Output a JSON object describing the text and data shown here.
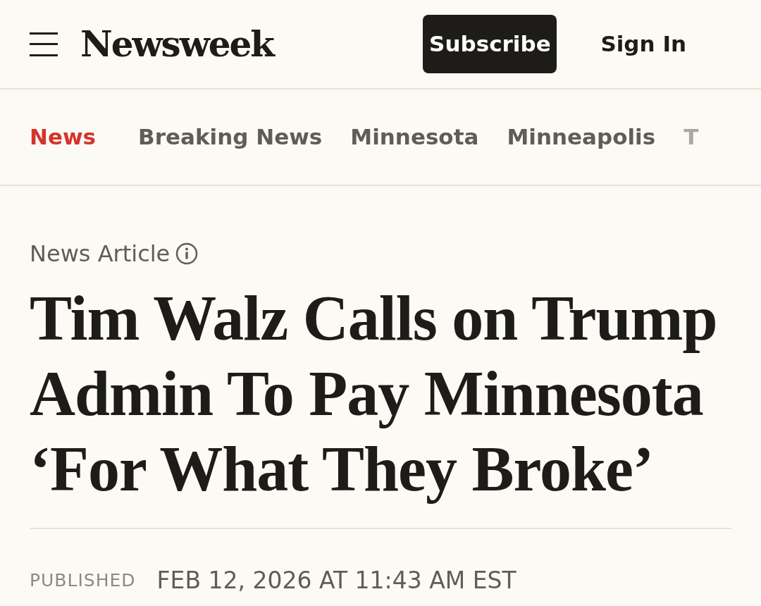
{
  "header": {
    "brand": "Newsweek",
    "subscribe": "Subscribe",
    "sign_in": "Sign In"
  },
  "nav": [
    {
      "label": "News",
      "selected": true
    },
    {
      "label": "Breaking News",
      "selected": false
    },
    {
      "label": "Minnesota",
      "selected": false
    },
    {
      "label": "Minneapolis",
      "selected": false
    },
    {
      "label": "T",
      "selected": false
    }
  ],
  "article": {
    "label": "News Article",
    "headline": "Tim Walz Calls on Trump Admin To Pay Minnesota ‘For What They Broke’",
    "published_label": "PUBLISHED",
    "published": "FEB 12, 2026 AT 11:43 AM EST"
  }
}
